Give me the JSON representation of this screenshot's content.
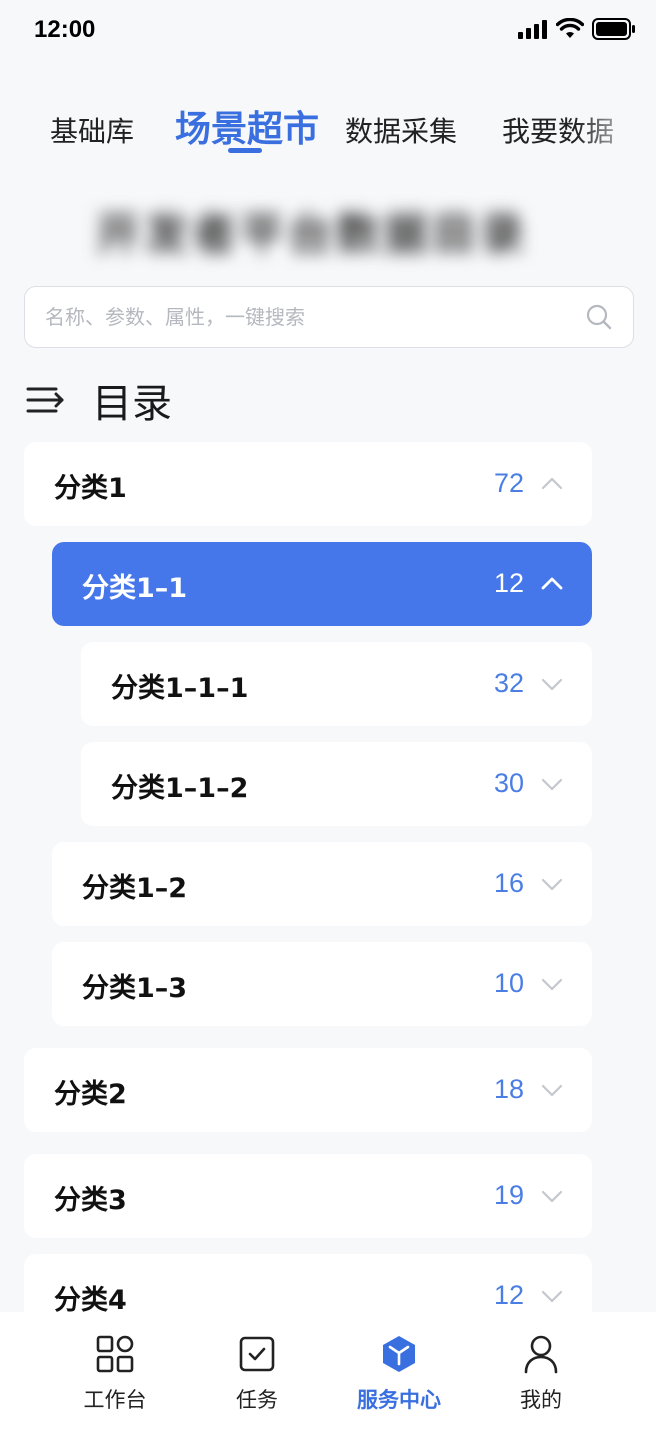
{
  "status_bar": {
    "time": "12:00"
  },
  "tabs": [
    {
      "label": "基础库",
      "active": false
    },
    {
      "label": "场景超市",
      "active": true
    },
    {
      "label": "数据采集",
      "active": false
    },
    {
      "label": "我要数据",
      "active": false
    }
  ],
  "banner": {
    "text": "开发者平台数据目录"
  },
  "search": {
    "placeholder": "名称、参数、属性，一键搜索",
    "value": ""
  },
  "directory": {
    "title": "目录"
  },
  "catalog": [
    {
      "label": "分类1",
      "count": "72",
      "expanded": true,
      "selected": false,
      "level": 0
    },
    {
      "label": "分类1–1",
      "count": "12",
      "expanded": true,
      "selected": true,
      "level": 1
    },
    {
      "label": "分类1–1–1",
      "count": "32",
      "expanded": false,
      "selected": false,
      "level": 2
    },
    {
      "label": "分类1–1–2",
      "count": "30",
      "expanded": false,
      "selected": false,
      "level": 2
    },
    {
      "label": "分类1–2",
      "count": "16",
      "expanded": false,
      "selected": false,
      "level": 1
    },
    {
      "label": "分类1–3",
      "count": "10",
      "expanded": false,
      "selected": false,
      "level": 1
    },
    {
      "label": "分类2",
      "count": "18",
      "expanded": false,
      "selected": false,
      "level": 0
    },
    {
      "label": "分类3",
      "count": "19",
      "expanded": false,
      "selected": false,
      "level": 0
    },
    {
      "label": "分类4",
      "count": "12",
      "expanded": false,
      "selected": false,
      "level": 0
    }
  ],
  "bottom_nav": [
    {
      "label": "工作台",
      "icon": "grid-icon",
      "active": false
    },
    {
      "label": "任务",
      "icon": "task-check-icon",
      "active": false
    },
    {
      "label": "服务中心",
      "icon": "service-cube-icon",
      "active": true
    },
    {
      "label": "我的",
      "icon": "user-icon",
      "active": false
    }
  ],
  "colors": {
    "accent": "#3a6fe0",
    "selected_row": "#4677ea",
    "count": "#4a7ee5",
    "background": "#f7f8fa"
  }
}
